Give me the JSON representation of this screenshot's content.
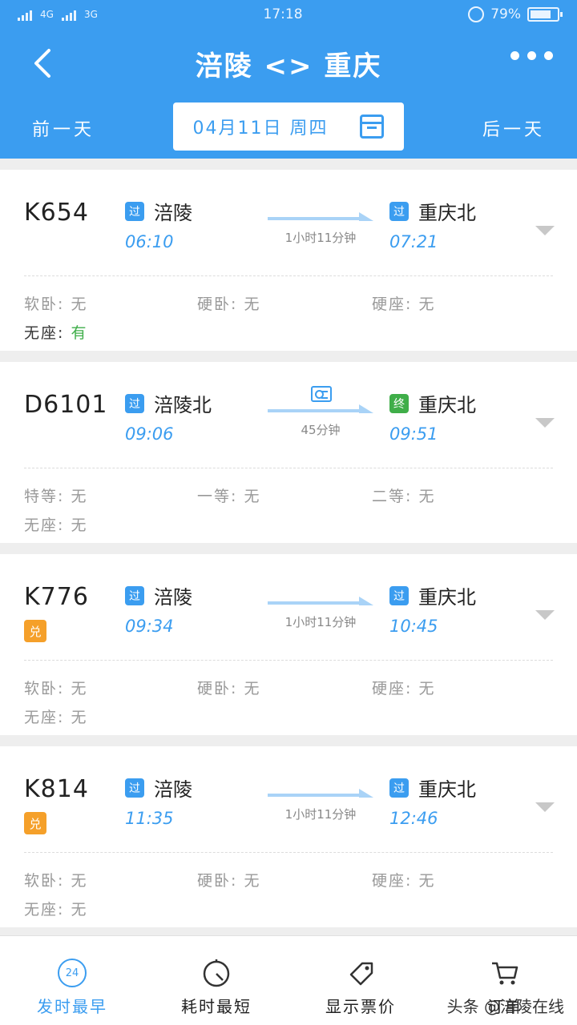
{
  "status_bar": {
    "network_1": "4G",
    "network_2": "3G",
    "time": "17:18",
    "battery": "79%",
    "battery_level": 0.79
  },
  "header": {
    "title": "涪陵 <> 重庆",
    "prev_day": "前一天",
    "next_day": "后一天",
    "date": "04月11日 周四"
  },
  "trains": [
    {
      "no": "K654",
      "badge": "",
      "from_tag": "过",
      "from": "涪陵",
      "dep": "06:10",
      "to_tag": "过",
      "to": "重庆北",
      "arr": "07:21",
      "duration": "1小时11分钟",
      "seats": [
        {
          "label": "软卧:",
          "value": "无"
        },
        {
          "label": "硬卧:",
          "value": "无"
        },
        {
          "label": "硬座:",
          "value": "无"
        },
        {
          "label": "无座:",
          "value": "有"
        }
      ]
    },
    {
      "no": "D6101",
      "badge": "",
      "from_tag": "过",
      "from": "涪陵北",
      "dep": "09:06",
      "to_tag": "终",
      "to": "重庆北",
      "arr": "09:51",
      "duration": "45分钟",
      "seats": [
        {
          "label": "特等:",
          "value": "无"
        },
        {
          "label": "一等:",
          "value": "无"
        },
        {
          "label": "二等:",
          "value": "无"
        },
        {
          "label": "无座:",
          "value": "无"
        }
      ]
    },
    {
      "no": "K776",
      "badge": "兑",
      "from_tag": "过",
      "from": "涪陵",
      "dep": "09:34",
      "to_tag": "过",
      "to": "重庆北",
      "arr": "10:45",
      "duration": "1小时11分钟",
      "seats": [
        {
          "label": "软卧:",
          "value": "无"
        },
        {
          "label": "硬卧:",
          "value": "无"
        },
        {
          "label": "硬座:",
          "value": "无"
        },
        {
          "label": "无座:",
          "value": "无"
        }
      ]
    },
    {
      "no": "K814",
      "badge": "兑",
      "from_tag": "过",
      "from": "涪陵",
      "dep": "11:35",
      "to_tag": "过",
      "to": "重庆北",
      "arr": "12:46",
      "duration": "1小时11分钟",
      "seats": [
        {
          "label": "软卧:",
          "value": "无"
        },
        {
          "label": "硬卧:",
          "value": "无"
        },
        {
          "label": "硬座:",
          "value": "无"
        },
        {
          "label": "无座:",
          "value": "无"
        }
      ]
    }
  ],
  "tabbar": {
    "tab1_icon_text": "24",
    "tab1": "发时最早",
    "tab2": "耗时最短",
    "tab3": "显示票价",
    "tab4": "订单",
    "watermark": "头条 @涪陵在线"
  },
  "colors": {
    "primary": "#3b9df0",
    "has_ticket": "#3fae49",
    "redeem": "#f5a02a"
  }
}
